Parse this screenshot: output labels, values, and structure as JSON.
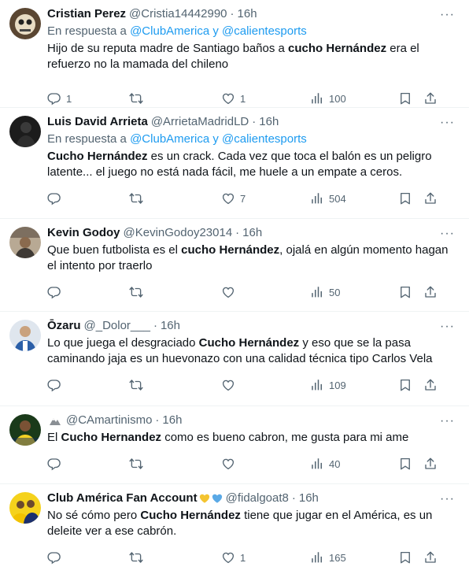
{
  "tweets": [
    {
      "name": "Cristian Perez",
      "handle": "@Cristia14442990",
      "dot": "·",
      "time": "16h",
      "reply_prefix": "En respuesta a",
      "reply_to": "@ClubAmerica y @calientesports",
      "text_parts": [
        "Hijo de su reputa madre de Santiago baños a ",
        "cucho Hernández",
        " era el refuerzo no la mamada del chileno"
      ],
      "replies": "1",
      "retweets": "",
      "likes": "1",
      "views": "100"
    },
    {
      "name": "Luis David Arrieta",
      "handle": "@ArrietaMadridLD",
      "dot": "·",
      "time": "16h",
      "reply_prefix": "En respuesta a",
      "reply_to": "@ClubAmerica y @calientesports",
      "text_parts": [
        "",
        "Cucho Hernández",
        " es un crack. Cada vez que toca el balón es un peligro latente... el juego no está nada fácil, me huele a un empate a ceros."
      ],
      "replies": "",
      "retweets": "",
      "likes": "7",
      "views": "504"
    },
    {
      "name": "Kevin Godoy",
      "handle": "@KevinGodoy23014",
      "dot": "·",
      "time": "16h",
      "text_parts": [
        "Que buen futbolista es el ",
        "cucho Hernández",
        ", ojalá en algún momento hagan el intento por traerlo"
      ],
      "replies": "",
      "retweets": "",
      "likes": "",
      "views": "50"
    },
    {
      "name": "Ōzaru",
      "handle": "@_Dolor___",
      "dot": "·",
      "time": "16h",
      "text_parts": [
        "Lo que juega el desgraciado ",
        "Cucho Hernández",
        " y eso que se la pasa caminando jaja es un huevonazo con una calidad técnica tipo Carlos Vela"
      ],
      "replies": "",
      "retweets": "",
      "likes": "",
      "views": "109"
    },
    {
      "name": "",
      "handle": "@CAmartinismo",
      "dot": "·",
      "time": "16h",
      "text_parts": [
        "El ",
        "Cucho Hernandez",
        " como es bueno cabron, me gusta para mi ame"
      ],
      "replies": "",
      "retweets": "",
      "likes": "",
      "views": "40"
    },
    {
      "name": "Club América Fan Account",
      "handle": "@fidalgoat8",
      "dot": "·",
      "time": "16h",
      "text_parts": [
        "No sé cómo pero ",
        "Cucho Hernández",
        " tiene que jugar en el América, es un deleite ver a ese cabrón."
      ],
      "replies": "",
      "retweets": "",
      "likes": "1",
      "views": "165"
    }
  ],
  "more_glyph": "···",
  "colors": {
    "text": "#0f1419",
    "muted": "#536471",
    "link": "#1d9bf0",
    "border": "#eff3f4"
  }
}
